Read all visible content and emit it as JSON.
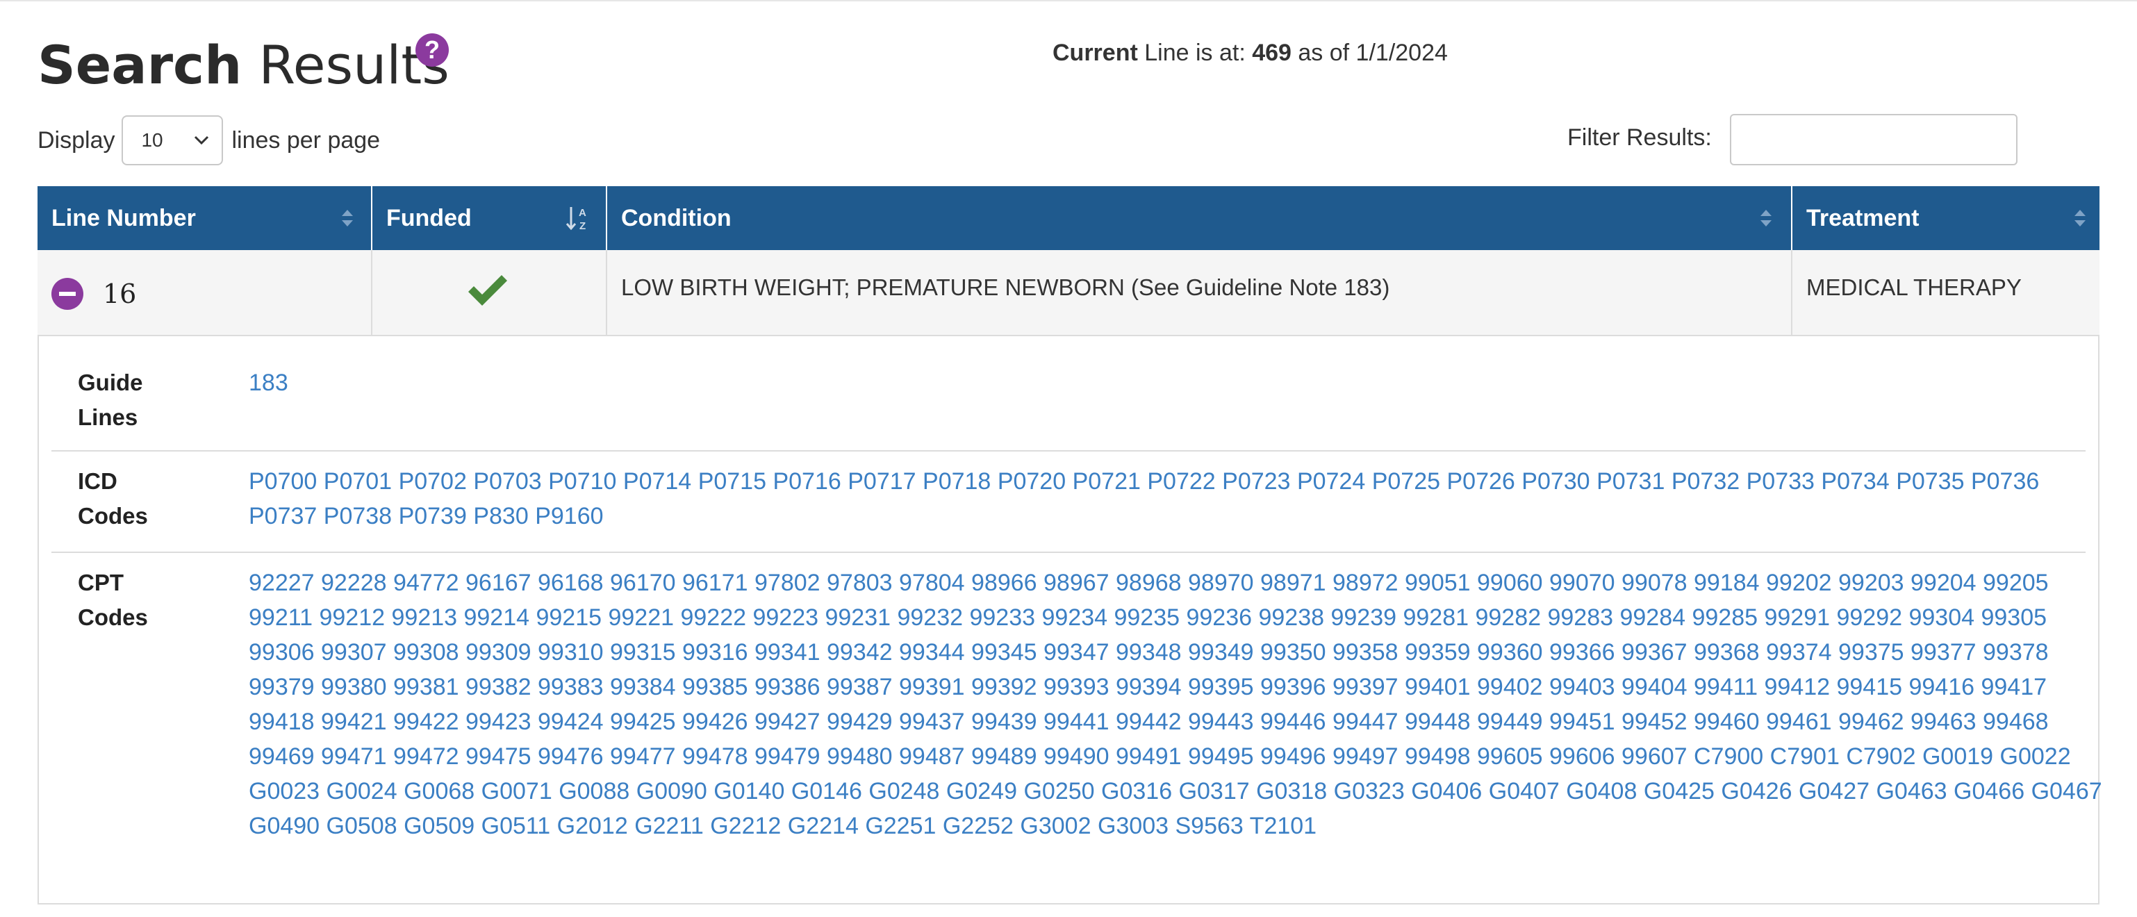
{
  "page": {
    "title_bold": "Search",
    "title_rest": " Results",
    "help_icon": "question-circle-icon"
  },
  "status": {
    "prefix_bold": "Current",
    "prefix": " Line is at: ",
    "line": "469",
    "suffix": " as of 1/1/2024"
  },
  "display": {
    "label": "Display",
    "selected": "10",
    "suffix": "lines per page"
  },
  "filter": {
    "label": "Filter Results:",
    "value": ""
  },
  "table": {
    "columns": [
      {
        "label": "Line Number",
        "sort_icon": "sort-both-icon"
      },
      {
        "label": "Funded",
        "sort_icon": "sort-alpha-asc-icon"
      },
      {
        "label": "Condition",
        "sort_icon": "sort-both-icon"
      },
      {
        "label": "Treatment",
        "sort_icon": "sort-both-icon"
      }
    ],
    "row": {
      "line_number": "16",
      "funded": true,
      "funded_icon": "checkmark-icon",
      "condition": "LOW BIRTH WEIGHT; PREMATURE NEWBORN (See Guideline Note 183)",
      "treatment": "MEDICAL THERAPY",
      "expand_icon": "minus-circle-icon"
    }
  },
  "details": {
    "guidelines": {
      "label_line1": "Guide",
      "label_line2": "Lines",
      "values": [
        "183"
      ]
    },
    "icd": {
      "label_line1": "ICD",
      "label_line2": "Codes",
      "values": [
        "P0700",
        "P0701",
        "P0702",
        "P0703",
        "P0710",
        "P0714",
        "P0715",
        "P0716",
        "P0717",
        "P0718",
        "P0720",
        "P0721",
        "P0722",
        "P0723",
        "P0724",
        "P0725",
        "P0726",
        "P0730",
        "P0731",
        "P0732",
        "P0733",
        "P0734",
        "P0735",
        "P0736",
        "P0737",
        "P0738",
        "P0739",
        "P830",
        "P9160"
      ]
    },
    "cpt": {
      "label_line1": "CPT",
      "label_line2": "Codes",
      "values": [
        "92227",
        "92228",
        "94772",
        "96167",
        "96168",
        "96170",
        "96171",
        "97802",
        "97803",
        "97804",
        "98966",
        "98967",
        "98968",
        "98970",
        "98971",
        "98972",
        "99051",
        "99060",
        "99070",
        "99078",
        "99184",
        "99202",
        "99203",
        "99204",
        "99205",
        "99211",
        "99212",
        "99213",
        "99214",
        "99215",
        "99221",
        "99222",
        "99223",
        "99231",
        "99232",
        "99233",
        "99234",
        "99235",
        "99236",
        "99238",
        "99239",
        "99281",
        "99282",
        "99283",
        "99284",
        "99285",
        "99291",
        "99292",
        "99304",
        "99305",
        "99306",
        "99307",
        "99308",
        "99309",
        "99310",
        "99315",
        "99316",
        "99341",
        "99342",
        "99344",
        "99345",
        "99347",
        "99348",
        "99349",
        "99350",
        "99358",
        "99359",
        "99360",
        "99366",
        "99367",
        "99368",
        "99374",
        "99375",
        "99377",
        "99378",
        "99379",
        "99380",
        "99381",
        "99382",
        "99383",
        "99384",
        "99385",
        "99386",
        "99387",
        "99391",
        "99392",
        "99393",
        "99394",
        "99395",
        "99396",
        "99397",
        "99401",
        "99402",
        "99403",
        "99404",
        "99411",
        "99412",
        "99415",
        "99416",
        "99417",
        "99418",
        "99421",
        "99422",
        "99423",
        "99424",
        "99425",
        "99426",
        "99427",
        "99429",
        "99437",
        "99439",
        "99441",
        "99442",
        "99443",
        "99446",
        "99447",
        "99448",
        "99449",
        "99451",
        "99452",
        "99460",
        "99461",
        "99462",
        "99463",
        "99468",
        "99469",
        "99471",
        "99472",
        "99475",
        "99476",
        "99477",
        "99478",
        "99479",
        "99480",
        "99487",
        "99489",
        "99490",
        "99491",
        "99495",
        "99496",
        "99497",
        "99498",
        "99605",
        "99606",
        "99607",
        "C7900",
        "C7901",
        "C7902",
        "G0019",
        "G0022",
        "G0023",
        "G0024",
        "G0068",
        "G0071",
        "G0088",
        "G0090",
        "G0140",
        "G0146",
        "G0248",
        "G0249",
        "G0250",
        "G0316",
        "G0317",
        "G0318",
        "G0323",
        "G0406",
        "G0407",
        "G0408",
        "G0425",
        "G0426",
        "G0427",
        "G0463",
        "G0466",
        "G0467",
        "G0490",
        "G0508",
        "G0509",
        "G0511",
        "G2012",
        "G2211",
        "G2212",
        "G2214",
        "G2251",
        "G2252",
        "G3002",
        "G3003",
        "S9563",
        "T2101"
      ]
    }
  },
  "colors": {
    "header_bg": "#1f5a8e",
    "accent_purple": "#8b3a9e",
    "link_blue": "#3b7fc4",
    "check_green": "#4a8a3c"
  }
}
